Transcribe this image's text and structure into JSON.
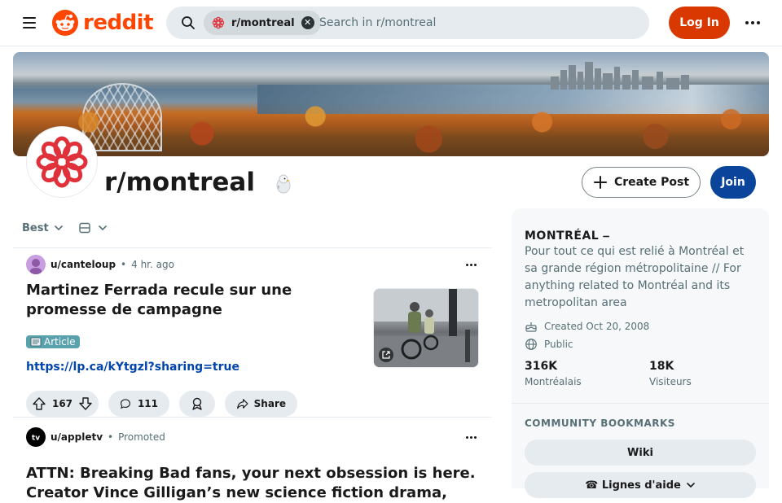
{
  "header": {
    "logo_text": "reddit",
    "search_chip": "r/montreal",
    "search_placeholder": "Search in r/montreal",
    "login_label": "Log In"
  },
  "community": {
    "name": "r/montreal",
    "create_post_label": "Create Post",
    "join_label": "Join"
  },
  "feed": {
    "sort_label": "Best",
    "posts": [
      {
        "author": "u/canteloup",
        "time": "4 hr. ago",
        "title": "Martinez Ferrada recule sur une promesse de campagne",
        "flair": "Article",
        "link": "https://lp.ca/kYtgzl?sharing=true",
        "votes": "167",
        "comments": "111",
        "share_label": "Share"
      },
      {
        "author": "u/appletv",
        "promoted_label": "Promoted",
        "title": "ATTN: Breaking Bad fans, your next obsession is here. Creator Vince Gilligan’s new science fiction drama,"
      }
    ]
  },
  "sidebar": {
    "title": "MONTRÉAL ⎯",
    "description": "Pour tout ce qui est relié à Montréal et sa grande région métropolitaine // For anything related to Montréal and its metropolitan area",
    "created": "Created Oct 20, 2008",
    "visibility": "Public",
    "members_count": "316K",
    "members_label": "Montréalais",
    "visitors_count": "18K",
    "visitors_label": "Visiteurs",
    "bookmarks_heading": "COMMUNITY BOOKMARKS",
    "bookmarks": [
      "Wiki",
      "☎ Lignes d'aide"
    ]
  },
  "colors": {
    "brand": "#ff4500",
    "login": "#d93900",
    "join": "#0a449b",
    "link": "#0045ac",
    "flair": "#59a1ad"
  }
}
